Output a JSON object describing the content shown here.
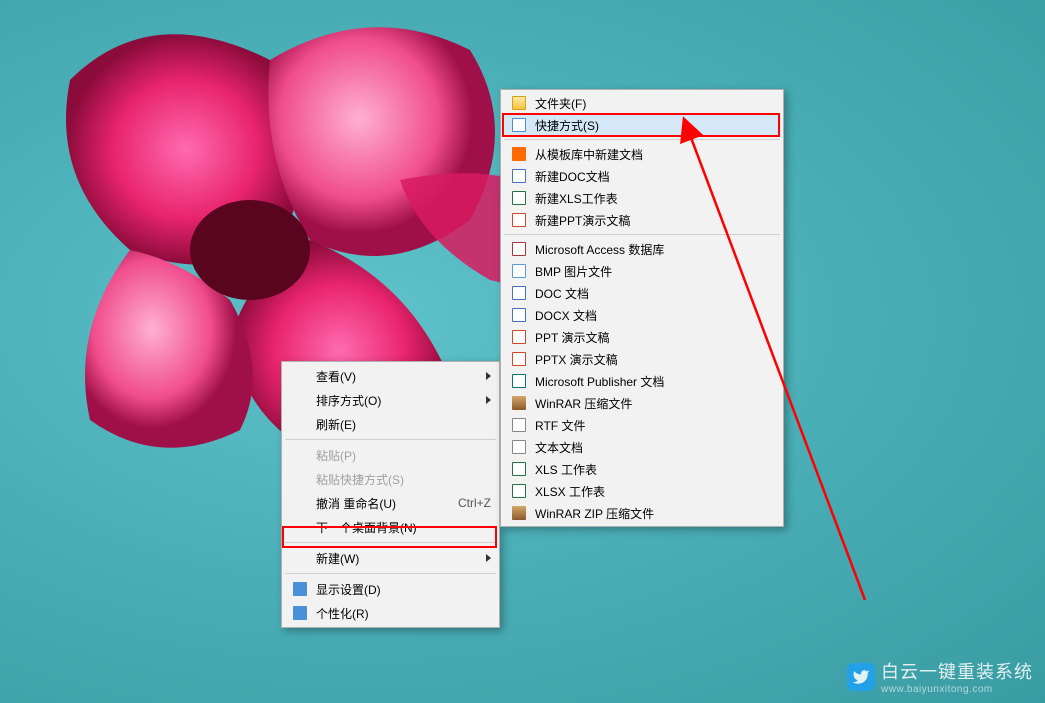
{
  "desktop": {
    "wallpaper_description": "pink flower on teal background"
  },
  "context_menu": {
    "items": [
      {
        "label": "查看(V)",
        "has_submenu": true
      },
      {
        "label": "排序方式(O)",
        "has_submenu": true
      },
      {
        "label": "刷新(E)"
      },
      {
        "separator": true
      },
      {
        "label": "粘贴(P)",
        "disabled": true
      },
      {
        "label": "粘贴快捷方式(S)",
        "disabled": true
      },
      {
        "label": "撤消 重命名(U)",
        "shortcut": "Ctrl+Z"
      },
      {
        "label": "下一个桌面背景(N)"
      },
      {
        "separator": true
      },
      {
        "label": "新建(W)",
        "has_submenu": true,
        "highlighted": true
      },
      {
        "separator": true
      },
      {
        "label": "显示设置(D)",
        "icon": "monitor"
      },
      {
        "label": "个性化(R)",
        "icon": "personalize"
      }
    ]
  },
  "submenu": {
    "items": [
      {
        "label": "文件夹(F)",
        "icon": "folder"
      },
      {
        "label": "快捷方式(S)",
        "icon": "shortcut",
        "highlighted": true
      },
      {
        "separator": true
      },
      {
        "label": "从模板库中新建文档",
        "icon": "orange"
      },
      {
        "label": "新建DOC文档",
        "icon": "doc"
      },
      {
        "label": "新建XLS工作表",
        "icon": "xls"
      },
      {
        "label": "新建PPT演示文稿",
        "icon": "ppt"
      },
      {
        "separator": true
      },
      {
        "label": "Microsoft Access 数据库",
        "icon": "access"
      },
      {
        "label": "BMP 图片文件",
        "icon": "bmp"
      },
      {
        "label": "DOC 文档",
        "icon": "doc"
      },
      {
        "label": "DOCX 文档",
        "icon": "doc"
      },
      {
        "label": "PPT 演示文稿",
        "icon": "ppt"
      },
      {
        "label": "PPTX 演示文稿",
        "icon": "ppt"
      },
      {
        "label": "Microsoft Publisher 文档",
        "icon": "pub"
      },
      {
        "label": "WinRAR 压缩文件",
        "icon": "rar"
      },
      {
        "label": "RTF 文件",
        "icon": "rtf"
      },
      {
        "label": "文本文档",
        "icon": "txt"
      },
      {
        "label": "XLS 工作表",
        "icon": "xls"
      },
      {
        "label": "XLSX 工作表",
        "icon": "xls"
      },
      {
        "label": "WinRAR ZIP 压缩文件",
        "icon": "rar"
      }
    ]
  },
  "watermark": {
    "brand": "白云一键重装系统",
    "url": "www.baiyunxitong.com"
  },
  "annotation": {
    "arrow_color": "#ff0000"
  }
}
